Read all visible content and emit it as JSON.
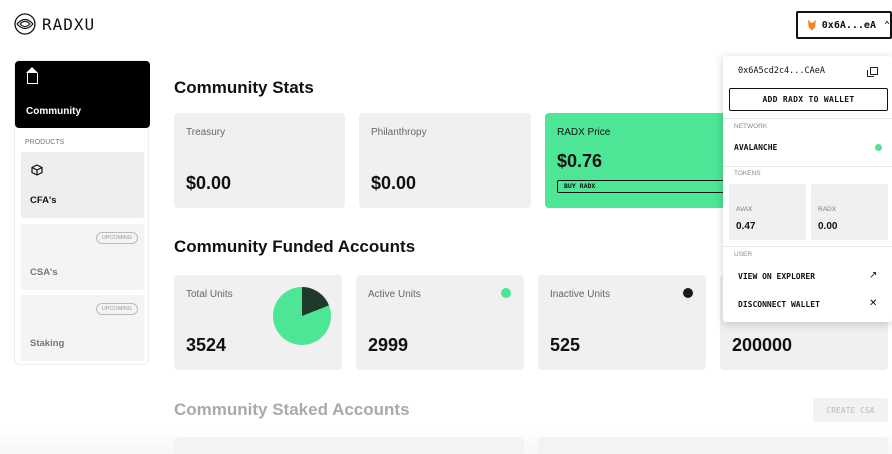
{
  "header": {
    "logo_text": "RADXU",
    "wallet_button_label": "0x6A...eA",
    "wallet_icon": "metamask-fox-icon",
    "chevron_icon": "chevron-up-icon"
  },
  "sidebar": {
    "community_label": "Community",
    "section_label": "PRODUCTS",
    "items": [
      {
        "label": "CFA's",
        "badge": ""
      },
      {
        "label": "CSA's",
        "badge": "UPCOMING"
      },
      {
        "label": "Staking",
        "badge": "UPCOMING"
      }
    ]
  },
  "main": {
    "stats_title": "Community Stats",
    "stats": [
      {
        "title": "Treasury",
        "value": "$0.00"
      },
      {
        "title": "Philanthropy",
        "value": "$0.00"
      }
    ],
    "price": {
      "title": "RADX Price",
      "value": "$0.76",
      "button": "BUY RADX"
    },
    "cfa_title": "Community Funded Accounts",
    "cfa_cards": [
      {
        "title": "Total Units",
        "value": "3524"
      },
      {
        "title": "Active Units",
        "value": "2999"
      },
      {
        "title": "Inactive Units",
        "value": "525"
      },
      {
        "title": "",
        "value": "200000"
      }
    ],
    "pie_active_fraction": 0.81,
    "csa_title": "Community Staked Accounts",
    "create_csa_label": "CREATE CSA"
  },
  "wallet_dropdown": {
    "address": "0x6A5cd2c4...CAeA",
    "add_button": "ADD RADX TO WALLET",
    "network_label": "NETWORK",
    "network_value": "AVALANCHE",
    "tokens_label": "TOKENS",
    "tokens": [
      {
        "name": "AVAX",
        "value": "0.47"
      },
      {
        "name": "RADX",
        "value": "0.00"
      }
    ],
    "user_label": "USER",
    "view_explorer": "VIEW ON EXPLORER",
    "disconnect": "DISCONNECT WALLET"
  },
  "colors": {
    "accent_green": "#4de697",
    "dark": "#111111",
    "card_bg": "#f0f0f0"
  }
}
